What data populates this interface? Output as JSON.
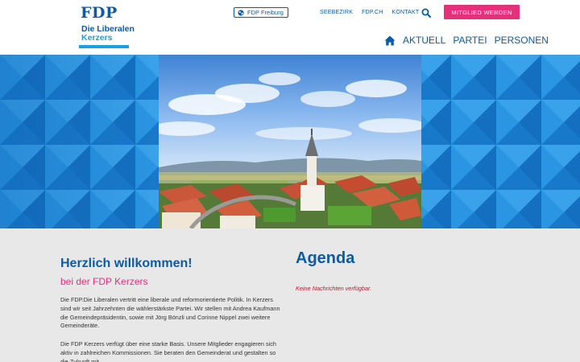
{
  "header": {
    "logo": {
      "main": "FDP",
      "line1": "Die Liberalen",
      "line2": "Kerzers"
    },
    "region_button": "FDP Freiburg",
    "top_links": [
      "SEEBEZIRK",
      "FDP.CH",
      "KONTAKT"
    ],
    "member_button": "MITGLIED WERDEN",
    "nav": [
      "AKTUELL",
      "PARTEI",
      "PERSONEN"
    ],
    "icons": {
      "globe": "globe-icon",
      "search": "search-icon",
      "home": "home-icon"
    }
  },
  "welcome": {
    "title": "Herzlich willkommen!",
    "subtitle": "bei der FDP Kerzers",
    "paragraph1": "Die FDP.Die Liberalen vertritt eine liberale und reformorientierte Politik. In Kerzers sind wir seit Jahrzehnten die wählerstärkste Partei. Wir stellen mit Andrea Kaufmann die Gemeindepräsidentin, sowie mit Jörg Bönzli und Corinne Nippel zwei weitere Gemeinderäte.",
    "paragraph2": "Die FDP Kerzers verfügt über eine starke Basis. Unsere Mitglieder engagieren sich aktiv in zahlreichen Kommissionen. Sie beraten den Gemeinderat und gestalten so die Zukunft mit."
  },
  "agenda": {
    "title": "Agenda",
    "empty_message": "Keine Nachrichten verfügbar."
  },
  "colors": {
    "brand_blue": "#0a5ba8",
    "accent_cyan": "#1aa0e0",
    "accent_pink": "#e6317a",
    "error_red": "#c0152b",
    "content_bg": "#e8e8e8"
  }
}
